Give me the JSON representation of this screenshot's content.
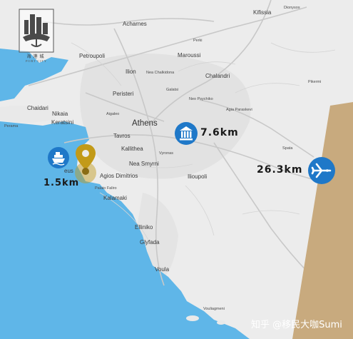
{
  "logo": {
    "cn": "海港城",
    "en": "PORT CITY"
  },
  "places": {
    "kifissia": "Kifissia",
    "dionysos": "Dionysos",
    "acharnes": "Acharnes",
    "perki": "Perki",
    "petroupoli": "Petroupoli",
    "maroussi": "Maroussi",
    "ilion": "Ilion",
    "nea_chalkidona": "Nea Chalkidona",
    "chalandri": "Chalandri",
    "galatsi": "Galatsi",
    "nea_psychiko": "Neo Psychiko",
    "pikermi": "Pikermi",
    "agia_paraskevi": "Agia Paraskevi",
    "peristeri": "Peristeri",
    "chaidari": "Chaidari",
    "nikaia": "Nikaia",
    "keratsini": "Keratsini",
    "aigaleo": "Aigaleo",
    "athens": "Athens",
    "perama": "Perama",
    "tavros": "Tavros",
    "kallithea": "Kallithea",
    "vyronas": "Vyronas",
    "spata": "Spata",
    "nea_smyrni": "Nea Smyrni",
    "ilioupoli": "Ilioupoli",
    "agios_dimitrios": "Agios Dimitrios",
    "piraeus_fragment": "eus",
    "palaio_faliro": "Palaio Faliro",
    "kalamaki": "Kalamaki",
    "elliniko": "Elliniko",
    "glyfada": "Glyfada",
    "voula": "Voula",
    "vouliagmeni": "Vouliagmeni"
  },
  "distances": {
    "port": "1.5km",
    "city_center": "7.6km",
    "airport": "26.3km"
  },
  "icons": {
    "port": "ship-icon",
    "city_center": "museum-icon",
    "airport": "airplane-icon",
    "location": "location-pin-icon"
  },
  "colors": {
    "sea": "#5fb6e8",
    "land": "#ececec",
    "marker_blue": "#1f78c8",
    "pin_gold": "#c29a18",
    "strip_tan": "#c8aa7e"
  },
  "watermark": "知乎 @移民大咖Sumi"
}
